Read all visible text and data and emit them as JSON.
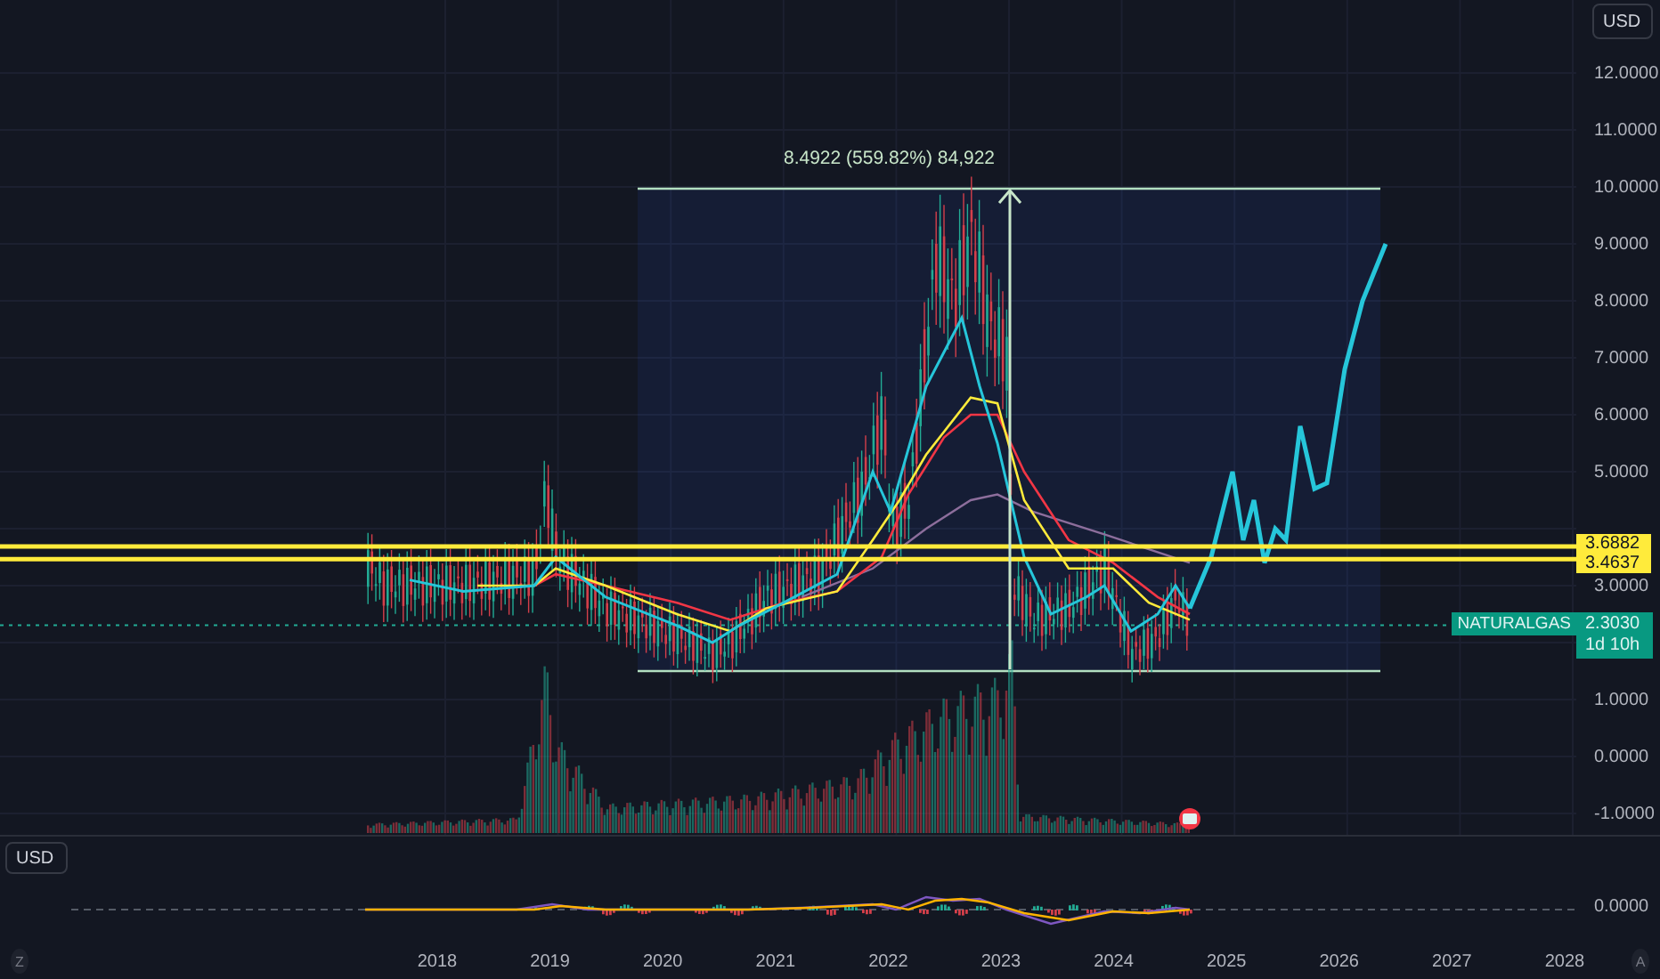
{
  "price_axis": {
    "currency_button": "USD",
    "ticks": [
      "12.0000",
      "11.0000",
      "10.0000",
      "9.0000",
      "8.0000",
      "7.0000",
      "6.0000",
      "5.0000",
      "3.0000",
      "1.0000",
      "0.0000",
      "-1.0000"
    ]
  },
  "measure": {
    "label": "8.4922 (559.82%) 84,922"
  },
  "levels": [
    {
      "price": "3.6882"
    },
    {
      "price": "3.4637"
    }
  ],
  "last_price": {
    "symbol": "NATURALGAS",
    "price": "2.3030",
    "countdown": "1d 10h"
  },
  "lower_pane": {
    "currency_button": "USD",
    "ticks": [
      "0.0000"
    ]
  },
  "time_axis": {
    "labels": [
      "2018",
      "2019",
      "2020",
      "2021",
      "2022",
      "2023",
      "2024",
      "2025",
      "2026",
      "2027",
      "2028"
    ]
  },
  "corner_buttons": {
    "left": "Z",
    "right": "A"
  }
}
